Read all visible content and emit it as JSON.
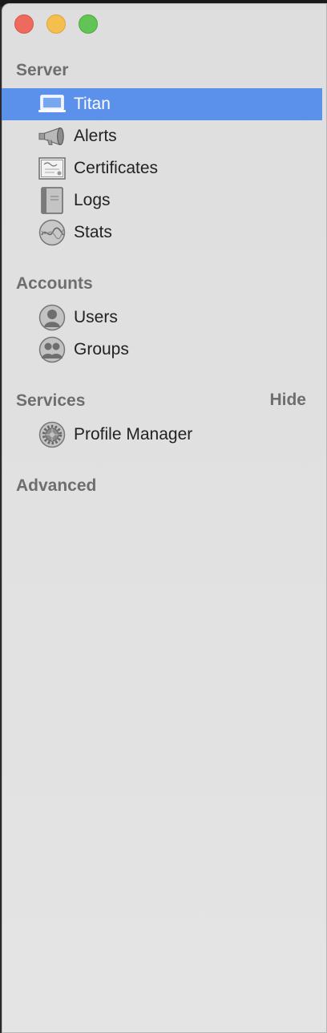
{
  "window": {
    "buttons": [
      "close",
      "minimize",
      "zoom"
    ]
  },
  "sidebar": {
    "server": {
      "heading": "Server",
      "items": [
        {
          "label": "Titan",
          "icon": "laptop-icon",
          "selected": true
        },
        {
          "label": "Alerts",
          "icon": "megaphone-icon",
          "selected": false
        },
        {
          "label": "Certificates",
          "icon": "certificate-icon",
          "selected": false
        },
        {
          "label": "Logs",
          "icon": "log-book-icon",
          "selected": false
        },
        {
          "label": "Stats",
          "icon": "stats-graph-icon",
          "selected": false
        }
      ]
    },
    "accounts": {
      "heading": "Accounts",
      "items": [
        {
          "label": "Users",
          "icon": "user-icon"
        },
        {
          "label": "Groups",
          "icon": "group-icon"
        }
      ]
    },
    "services": {
      "heading": "Services",
      "hide_label": "Hide",
      "items": [
        {
          "label": "Profile Manager",
          "icon": "gear-icon"
        }
      ]
    },
    "advanced": {
      "heading": "Advanced"
    }
  },
  "colors": {
    "selection": "#5b91eb",
    "section_heading": "#6e6e6e"
  }
}
